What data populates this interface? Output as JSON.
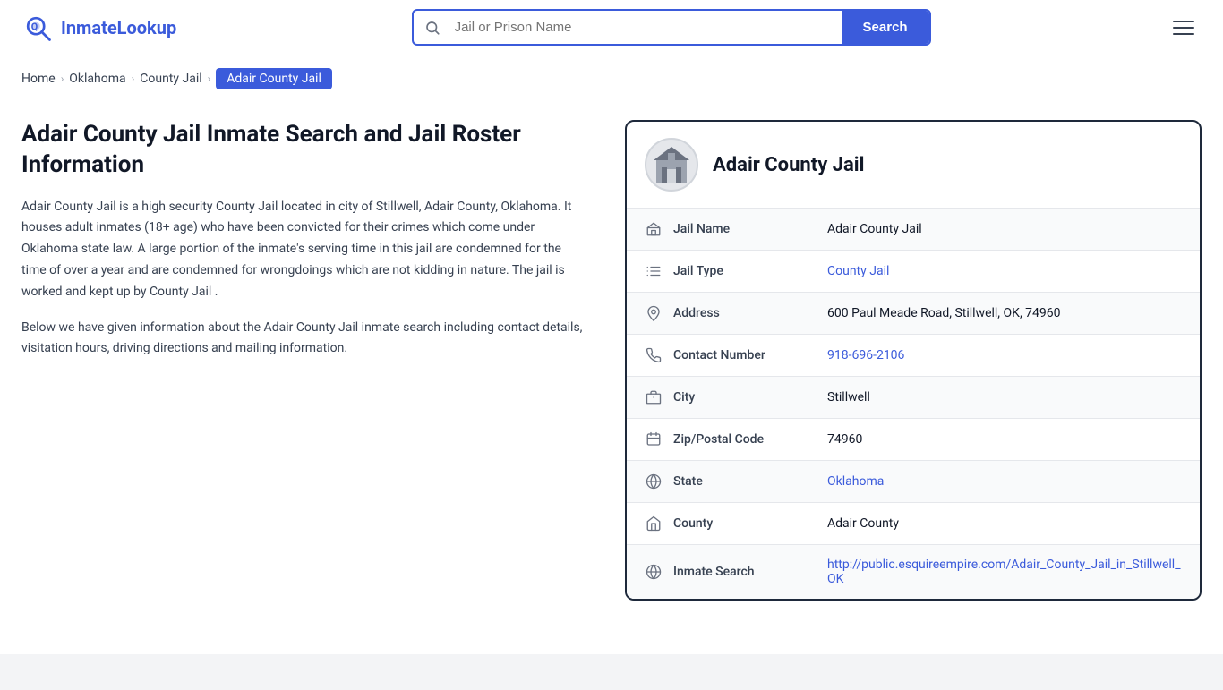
{
  "header": {
    "logo_text_1": "Inmate",
    "logo_text_2": "Lookup",
    "search_placeholder": "Jail or Prison Name",
    "search_button_label": "Search"
  },
  "breadcrumb": {
    "home": "Home",
    "oklahoma": "Oklahoma",
    "county_jail": "County Jail",
    "current": "Adair County Jail"
  },
  "left": {
    "title": "Adair County Jail Inmate Search and Jail Roster Information",
    "desc1": "Adair County Jail is a high security County Jail located in city of Stillwell, Adair County, Oklahoma. It houses adult inmates (18+ age) who have been convicted for their crimes which come under Oklahoma state law. A large portion of the inmate's serving time in this jail are condemned for the time of over a year and are condemned for wrongdoings which are not kidding in nature. The jail is worked and kept up by County Jail .",
    "desc2": "Below we have given information about the Adair County Jail inmate search including contact details, visitation hours, driving directions and mailing information."
  },
  "card": {
    "title": "Adair County Jail",
    "rows": [
      {
        "icon": "jail-icon",
        "label": "Jail Name",
        "value": "Adair County Jail",
        "link": null
      },
      {
        "icon": "type-icon",
        "label": "Jail Type",
        "value": "County Jail",
        "link": "#"
      },
      {
        "icon": "location-icon",
        "label": "Address",
        "value": "600 Paul Meade Road, Stillwell, OK, 74960",
        "link": null
      },
      {
        "icon": "phone-icon",
        "label": "Contact Number",
        "value": "918-696-2106",
        "link": "tel:918-696-2106"
      },
      {
        "icon": "city-icon",
        "label": "City",
        "value": "Stillwell",
        "link": null
      },
      {
        "icon": "zip-icon",
        "label": "Zip/Postal Code",
        "value": "74960",
        "link": null
      },
      {
        "icon": "state-icon",
        "label": "State",
        "value": "Oklahoma",
        "link": "#"
      },
      {
        "icon": "county-icon",
        "label": "County",
        "value": "Adair County",
        "link": null
      },
      {
        "icon": "globe-icon",
        "label": "Inmate Search",
        "value": "http://public.esquireempire.com/Adair_County_Jail_in_Stillwell_OK",
        "link": "http://public.esquireempire.com/Adair_County_Jail_in_Stillwell_OK"
      }
    ]
  },
  "colors": {
    "accent": "#3b5bdb",
    "dark": "#1e293b"
  }
}
